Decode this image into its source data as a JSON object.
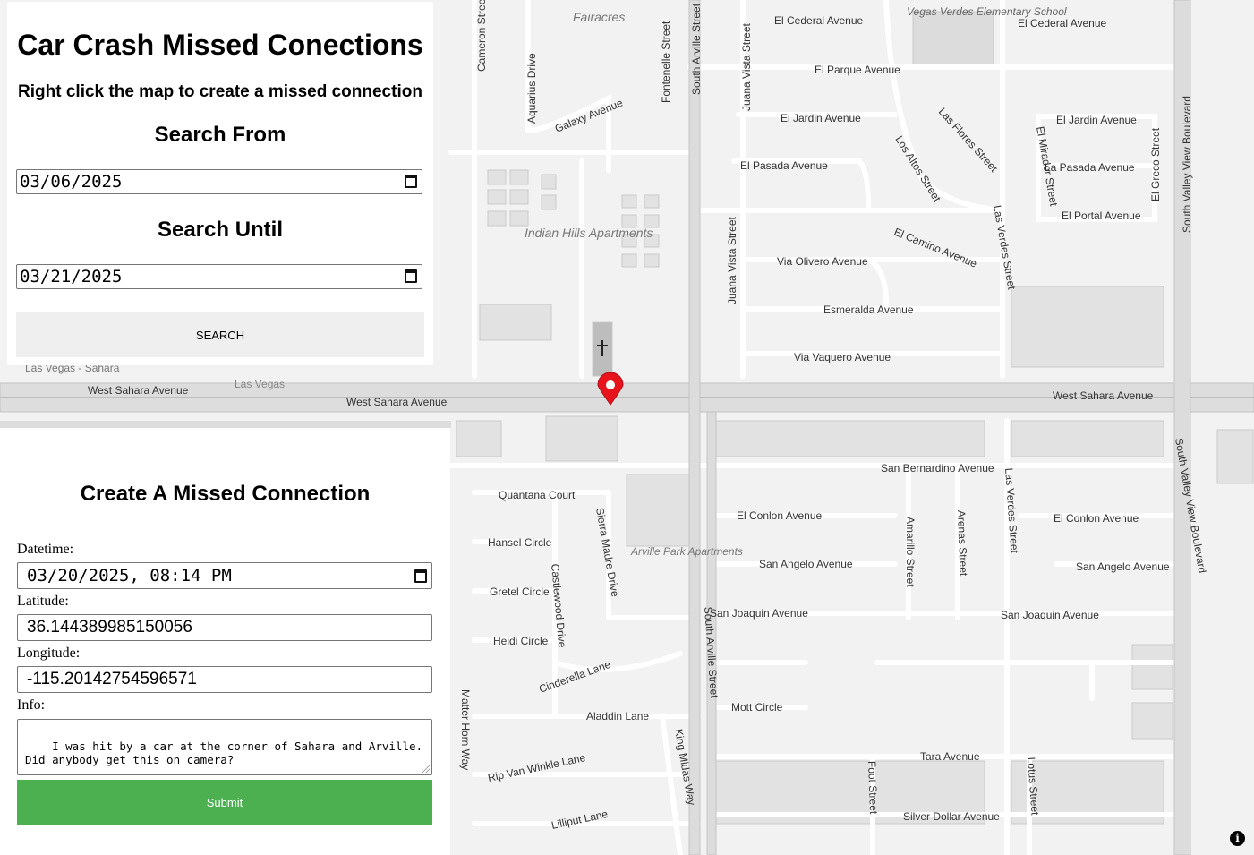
{
  "search_panel": {
    "title": "Car Crash Missed Conections",
    "subtitle": "Right click the map to create a missed connection",
    "from_heading": "Search From",
    "from_value": "03/06/2025",
    "until_heading": "Search Until",
    "until_value": "03/21/2025",
    "search_label": "SEARCH"
  },
  "create_panel": {
    "heading": "Create A Missed Connection",
    "datetime_label": "Datetime:",
    "datetime_value": "03/20/2025, 08:14 PM",
    "latitude_label": "Latitude:",
    "latitude_value": "36.144389985150056",
    "longitude_label": "Longitude:",
    "longitude_value": "-115.20142754596571",
    "info_label": "Info:",
    "info_value": "I was hit by a car at the corner of Sahara and Arville.\nDid anybody get this on camera?",
    "submit_label": "Submit"
  },
  "map": {
    "attribution_icon": "info-icon",
    "marker_color": "#e8141c",
    "labels": {
      "fairacres": "Fairacres",
      "cameron_street": "Cameron Street",
      "aquarius_drive": "Aquarius Drive",
      "galaxy_avenue": "Galaxy Avenue",
      "fontenelle_street": "Fontenelle Street",
      "south_arville_north": "South Arville Street",
      "juana_vista_north": "Juana Vista Street",
      "el_cederal_1": "El Cederal Avenue",
      "el_cederal_2": "El Cederal Avenue",
      "school": "Vegas Verdes Elementary School",
      "el_parque": "El Parque Avenue",
      "el_jardin_1": "El Jardin Avenue",
      "el_jardin_2": "El Jardin Avenue",
      "los_altos": "Los Altos Street",
      "las_flores": "Las Flores Street",
      "el_mirador": "El Mirador Street",
      "el_greco": "El Greco Street",
      "south_valley_view_north": "South Valley View Boulevard",
      "el_pasada": "El Pasada Avenue",
      "la_pasada": "La Pasada Avenue",
      "el_portal": "El Portal Avenue",
      "indian_hills": "Indian Hills Apartments",
      "juana_vista_mid": "Juana Vista Street",
      "via_olivero": "Via Olivero Avenue",
      "el_camino": "El Camino Avenue",
      "las_verdes_north": "Las Verdes Street",
      "esmeralda": "Esmeralda Avenue",
      "via_vaquero": "Via Vaquero Avenue",
      "las_vegas_sahara": "Las Vegas - Sahara",
      "las_vegas": "Las Vegas",
      "west_sahara_1": "West Sahara Avenue",
      "west_sahara_2": "West Sahara Avenue",
      "west_sahara_3": "West Sahara Avenue",
      "san_bernardino": "San Bernardino Avenue",
      "south_valley_view_south": "South Valley View Boulevard",
      "quantana_court": "Quantana Court",
      "sierra_madre": "Sierra Madre Drive",
      "el_conlon_1": "El Conlon Avenue",
      "el_conlon_2": "El Conlon Avenue",
      "amarillo": "Amarillo Street",
      "arenas": "Arenas Street",
      "las_verdes_south": "Las Verdes Street",
      "hansel_circle": "Hansel Circle",
      "arville_park": "Arville Park Apartments",
      "castlewood": "Castlewood Drive",
      "san_angelo_1": "San Angelo Avenue",
      "san_angelo_2": "San Angelo Avenue",
      "gretel_circle": "Gretel Circle",
      "san_joaquin_1": "San Joaquin Avenue",
      "san_joaquin_2": "San Joaquin Avenue",
      "south_arville_south": "South Arville Street",
      "heidi_circle": "Heidi Circle",
      "cinderella": "Cinderella Lane",
      "mott_circle": "Mott Circle",
      "matter_horn": "Matter Horn Way",
      "aladdin": "Aladdin Lane",
      "king_midas": "King Midas Way",
      "tara": "Tara Avenue",
      "rip_van_winkle": "Rip Van Winkle Lane",
      "foot_street": "Foot Street",
      "lotus_street": "Lotus Street",
      "lilliput": "Lilliput Lane",
      "silver_dollar": "Silver Dollar Avenue"
    }
  }
}
